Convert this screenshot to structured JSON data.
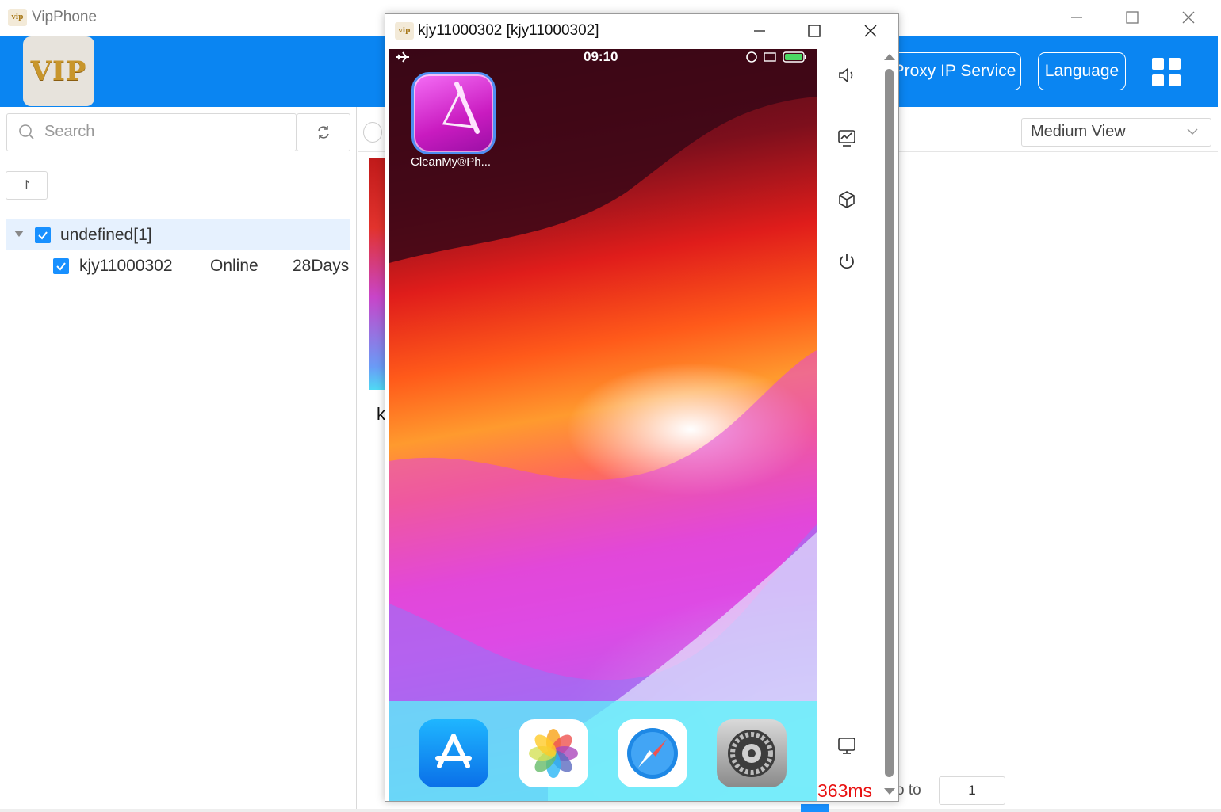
{
  "main_window": {
    "title": "VipPhone",
    "logo_text": "VIP",
    "title_icon_text": "vip"
  },
  "header": {
    "proxy_button": "Proxy IP Service",
    "language_button": "Language",
    "grid_icon": "grid-icon"
  },
  "sidebar": {
    "search_placeholder": "Search",
    "refresh_icon": "refresh-icon",
    "sort_icon_glyph": "↾",
    "group": {
      "label": "undefined[1]",
      "checked": true
    },
    "devices": [
      {
        "name": "kjy11000302",
        "status": "Online",
        "days": "28Days",
        "checked": true
      }
    ]
  },
  "main_area": {
    "view_select": "Medium View",
    "card_letter": "k",
    "go_to_label": "o to",
    "page_input_value": "1"
  },
  "device_window": {
    "title": "kjy11000302  [kjy11000302]",
    "title_icon_text": "vip",
    "status_time": "09:10",
    "apps": [
      {
        "label": "CleanMy®Ph...",
        "icon": "cleanmyphone-icon"
      }
    ],
    "dock_apps": [
      "app-store-icon",
      "photos-icon",
      "safari-icon",
      "settings-icon"
    ],
    "latency": "363ms",
    "tools": [
      "volume-icon",
      "screen-monitor-icon",
      "cube-icon",
      "power-icon",
      "desktop-icon"
    ]
  },
  "colors": {
    "header_blue": "#0a85f2",
    "accent": "#1890ff",
    "latency_red": "#e81010"
  }
}
